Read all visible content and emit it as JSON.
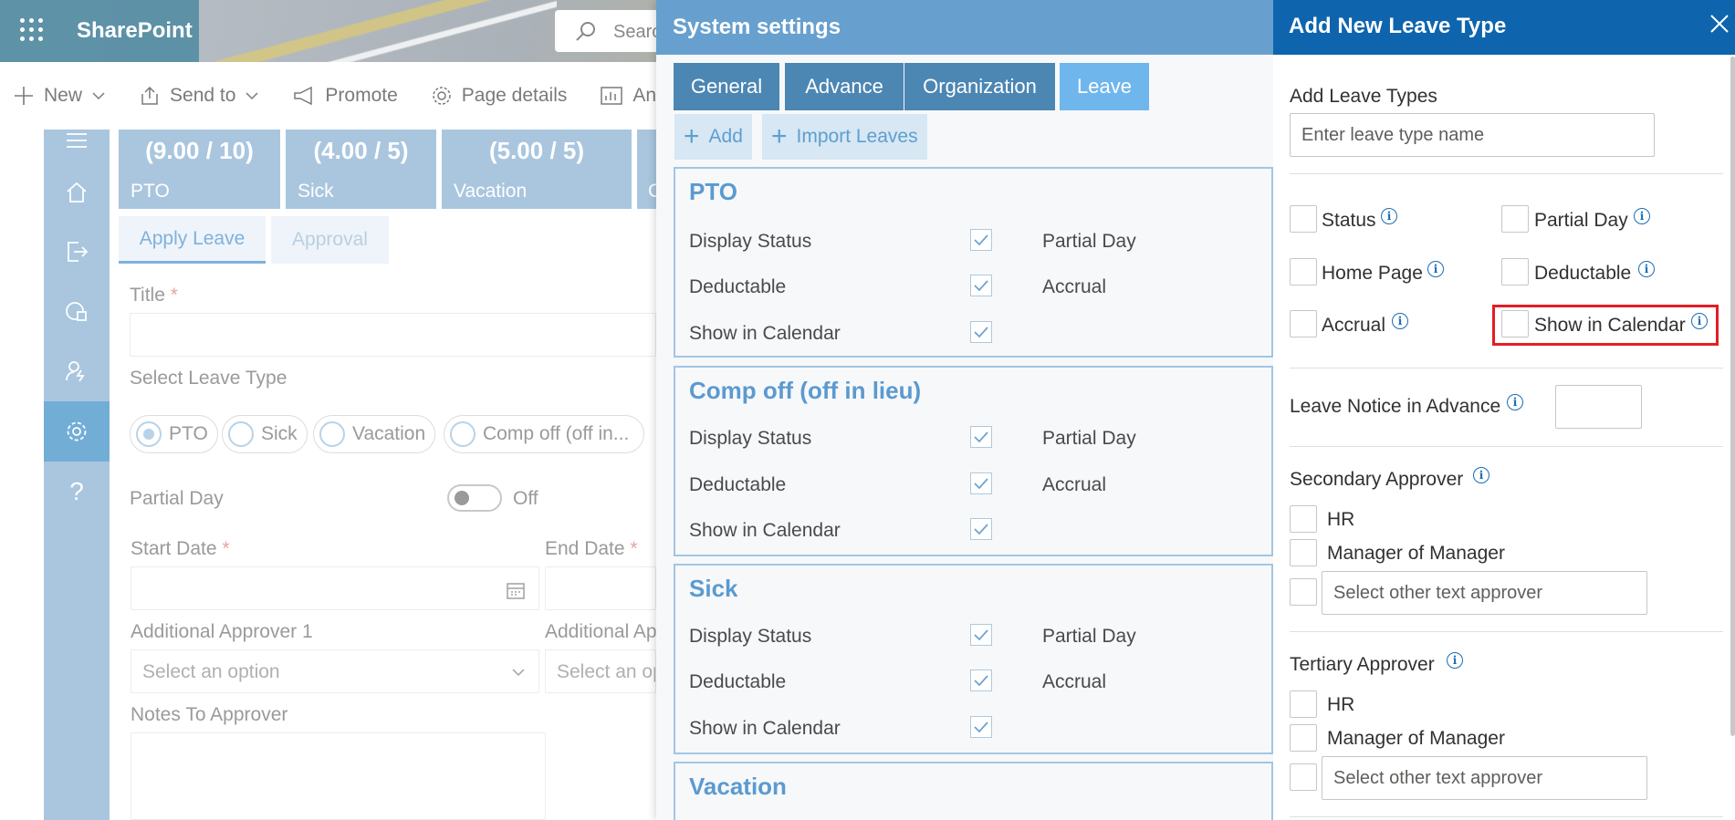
{
  "sharepoint": {
    "app_name": "SharePoint",
    "search_placeholder": "Searc",
    "commands": [
      {
        "label": "New",
        "icon": "plus-icon"
      },
      {
        "label": "Send to",
        "icon": "share-icon"
      },
      {
        "label": "Promote",
        "icon": "megaphone-icon"
      },
      {
        "label": "Page details",
        "icon": "gear-icon"
      },
      {
        "label": "An",
        "icon": "analytics-icon"
      }
    ],
    "tiles": [
      {
        "value": "(9.00 / 10)",
        "name": "PTO"
      },
      {
        "value": "(4.00 / 5)",
        "name": "Sick"
      },
      {
        "value": "(5.00 / 5)",
        "name": "Vacation"
      },
      {
        "value": "",
        "name": "C"
      }
    ],
    "tabs": {
      "apply": "Apply Leave",
      "approval": "Approval"
    },
    "form": {
      "title_label": "Title",
      "required_mark": "*",
      "select_leave_label": "Select Leave Type",
      "leave_options": [
        "PTO",
        "Sick",
        "Vacation",
        "Comp off (off in..."
      ],
      "partial_day_label": "Partial Day",
      "partial_day_state": "Off",
      "start_date_label": "Start Date",
      "end_date_label": "End Date",
      "approver1_label": "Additional Approver 1",
      "approver2_label": "Additional Ap",
      "select_placeholder": "Select an option",
      "select_placeholder_cut": "Select an op",
      "notes_label": "Notes To Approver"
    }
  },
  "system_settings": {
    "title": "System settings",
    "tabs": [
      "General",
      "Advance",
      "Organization",
      "Leave"
    ],
    "active_tab": "Leave",
    "add_label": "Add",
    "import_label": "Import Leaves",
    "leave_cards": [
      {
        "name": "PTO",
        "display_status": "Display Status",
        "deductable": "Deductable",
        "show_in_calendar": "Show in Calendar",
        "partial_day": "Partial Day",
        "accrual": "Accrual"
      },
      {
        "name": "Comp off (off in lieu)",
        "display_status": "Display Status",
        "deductable": "Deductable",
        "show_in_calendar": "Show in Calendar",
        "partial_day": "Partial Day",
        "accrual": "Accrual"
      },
      {
        "name": "Sick",
        "display_status": "Display Status",
        "deductable": "Deductable",
        "show_in_calendar": "Show in Calendar",
        "partial_day": "Partial Day",
        "accrual": "Accrual"
      },
      {
        "name": "Vacation"
      }
    ]
  },
  "add_leave_type": {
    "title": "Add New Leave Type",
    "add_leave_types_label": "Add Leave Types",
    "leave_type_placeholder": "Enter leave type name",
    "options": {
      "status": "Status",
      "partial_day": "Partial Day",
      "home_page": "Home Page",
      "deductable": "Deductable",
      "accrual": "Accrual",
      "show_in_calendar": "Show in Calendar"
    },
    "leave_notice_label": "Leave Notice in Advance",
    "secondary_approver": {
      "label": "Secondary Approver",
      "hr": "HR",
      "manager": "Manager of Manager",
      "other_placeholder": "Select other text approver"
    },
    "tertiary_approver": {
      "label": "Tertiary Approver",
      "hr": "HR",
      "manager": "Manager of Manager",
      "other_placeholder": "Select other text approver"
    },
    "info_glyph": "i"
  }
}
